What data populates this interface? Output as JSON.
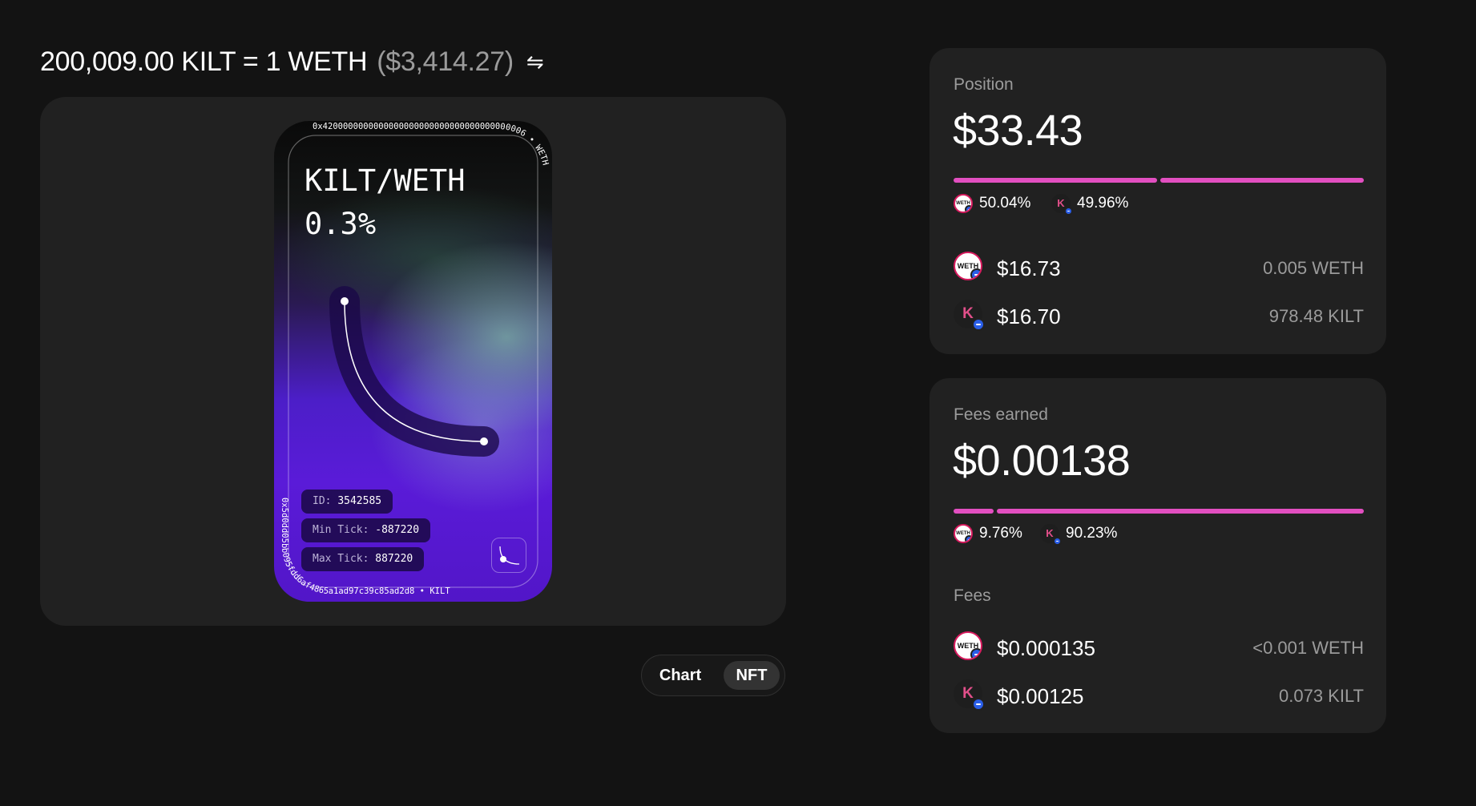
{
  "header": {
    "rate": "200,009.00 KILT = 1 WETH",
    "rate_usd": "($3,414.27)",
    "swap_icon": "swap-arrows-icon"
  },
  "nft": {
    "pair": "KILT/WETH",
    "fee": "0.3%",
    "top_address": "0x4200000000000000000000000000000000000006 • WETH",
    "bottom_address": "0x5d0dd05bb095fdd6af4865a1ad97c39c85ad2d8 • KILT",
    "id_label": "ID:",
    "id_value": "3542585",
    "min_tick_label": "Min Tick:",
    "min_tick_value": "-887220",
    "max_tick_label": "Max Tick:",
    "max_tick_value": "887220"
  },
  "view_toggle": {
    "chart_label": "Chart",
    "nft_label": "NFT",
    "selected": "NFT"
  },
  "position": {
    "label": "Position",
    "value": "$33.43",
    "weth_pct": "50.04%",
    "kilt_pct": "49.96%",
    "weth_share": 0.5004,
    "tokens": [
      {
        "symbol": "WETH",
        "usd": "$16.73",
        "amount": "0.005 WETH",
        "icon": "weth-token-icon"
      },
      {
        "symbol": "KILT",
        "usd": "$16.70",
        "amount": "978.48 KILT",
        "icon": "kilt-token-icon"
      }
    ]
  },
  "fees_earned": {
    "label": "Fees earned",
    "value": "$0.00138",
    "weth_pct": "9.76%",
    "kilt_pct": "90.23%",
    "weth_share": 0.0976,
    "fees_label": "Fees",
    "tokens": [
      {
        "symbol": "WETH",
        "usd": "$0.000135",
        "amount": "<0.001 WETH",
        "icon": "weth-token-icon"
      },
      {
        "symbol": "KILT",
        "usd": "$0.00125",
        "amount": "0.073 KILT",
        "icon": "kilt-token-icon"
      }
    ]
  },
  "colors": {
    "background": "#131313",
    "panel": "#212121",
    "accent_pink": "#e24fc0",
    "muted_text": "#9b9b9b",
    "nft_purple": "#5a1bd8"
  }
}
